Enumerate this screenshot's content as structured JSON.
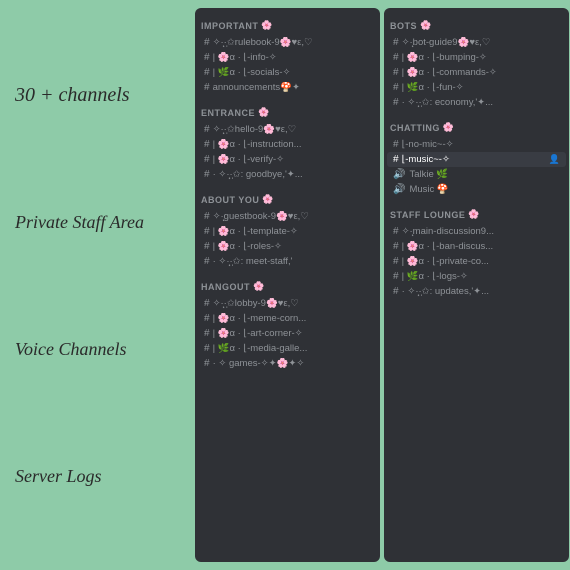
{
  "background": "#8ecba8",
  "labels": [
    {
      "id": "channels",
      "text": "30 + channels",
      "size": "small"
    },
    {
      "id": "staff",
      "text": "Private Staff Area",
      "size": "medium"
    },
    {
      "id": "voice",
      "text": "Voice Channels",
      "size": "medium"
    },
    {
      "id": "logs",
      "text": "Server Logs",
      "size": "medium"
    }
  ],
  "panel_left": {
    "categories": [
      {
        "name": "IMPORTANT",
        "emoji": "🌸",
        "channels": [
          {
            "type": "text",
            "name": "✧·̩͙·̩✩✮rulebook-9🌸♥ε,♡",
            "prefix": "#"
          },
          {
            "type": "text",
            "name": "| 🌸α · ⌊-info-✧",
            "prefix": "#"
          },
          {
            "type": "text",
            "name": "| 🌿α · ⌊-socials-✧",
            "prefix": "#"
          },
          {
            "type": "text",
            "name": "announcements🍄✦",
            "prefix": "#"
          }
        ]
      },
      {
        "name": "ENTRANCE",
        "emoji": "🌸",
        "channels": [
          {
            "type": "text",
            "name": "✧·̩͙·̩✩hello-9🌸♥ε,♡",
            "prefix": "#"
          },
          {
            "type": "text",
            "name": "| 🌸α · ⌊-instruction...",
            "prefix": "#"
          },
          {
            "type": "text",
            "name": "| 🌸α · ⌊-verify-✧",
            "prefix": "#"
          },
          {
            "type": "text",
            "name": "· ✧·̩͙·̩✩: goodbye,✦...",
            "prefix": "#"
          }
        ]
      },
      {
        "name": "ABOUT YOU",
        "emoji": "🌸",
        "channels": [
          {
            "type": "text",
            "name": "✧·̩͙guestbook-9🌸♥ε,♡",
            "prefix": "#"
          },
          {
            "type": "text",
            "name": "| 🌸α · ⌊-template-✧",
            "prefix": "#"
          },
          {
            "type": "text",
            "name": "| 🌸α · ⌊-roles-✧",
            "prefix": "#"
          },
          {
            "type": "text",
            "name": "· ✧·̩͙·̩✩: meet-staff,'",
            "prefix": "#"
          }
        ]
      },
      {
        "name": "HANGOUT",
        "emoji": "🌸",
        "channels": [
          {
            "type": "text",
            "name": "✧·̩͙·̩✩lobby-9🌸♥ε,♡",
            "prefix": "#"
          },
          {
            "type": "text",
            "name": "| 🌸α · ⌊-meme-corn...",
            "prefix": "#"
          },
          {
            "type": "text",
            "name": "| 🌸α · ⌊-art-corner-✧",
            "prefix": "#"
          },
          {
            "type": "text",
            "name": "| 🌿α · ⌊-media-galle...",
            "prefix": "#"
          },
          {
            "type": "text",
            "name": "· ✧ games-✧✦🌸✦✧",
            "prefix": "#"
          }
        ]
      }
    ]
  },
  "panel_right": {
    "categories": [
      {
        "name": "BOTS",
        "emoji": "🌸",
        "channels": [
          {
            "type": "text",
            "name": "✧·̩͙bot-guide9🌸♥ε,♡",
            "prefix": "#"
          },
          {
            "type": "text",
            "name": "| 🌸α · ⌊-bumping-✧",
            "prefix": "#"
          },
          {
            "type": "text",
            "name": "| 🌸α · ⌊-commands-✧",
            "prefix": "#"
          },
          {
            "type": "text",
            "name": "| 🌿α · ⌊-fun-✧",
            "prefix": "#"
          },
          {
            "type": "text",
            "name": "· ✧·̩͙·̩✩: economy,'✦...",
            "prefix": "#"
          }
        ]
      },
      {
        "name": "CHATTING",
        "emoji": "🌸",
        "channels": [
          {
            "type": "text",
            "name": "⌊-no-mic~-✧",
            "prefix": "#"
          },
          {
            "type": "text",
            "name": "⌊-music~-✧",
            "prefix": "#",
            "active": true
          },
          {
            "type": "voice",
            "name": "Talkie 🌿"
          },
          {
            "type": "voice",
            "name": "Music 🍄"
          }
        ]
      },
      {
        "name": "STAFF LOUNGE",
        "emoji": "🌸",
        "channels": [
          {
            "type": "text",
            "name": "✧·̩͙main-discussion9...",
            "prefix": "#"
          },
          {
            "type": "text",
            "name": "| 🌸α · ⌊-ban-discus...",
            "prefix": "#"
          },
          {
            "type": "text",
            "name": "| 🌸α · ⌊-private-co...",
            "prefix": "#"
          },
          {
            "type": "text",
            "name": "| 🌿α · ⌊-logs-✧",
            "prefix": "#"
          },
          {
            "type": "text",
            "name": "· ✧·̩͙·̩✩: updates,'✦...",
            "prefix": "#"
          }
        ]
      }
    ]
  }
}
